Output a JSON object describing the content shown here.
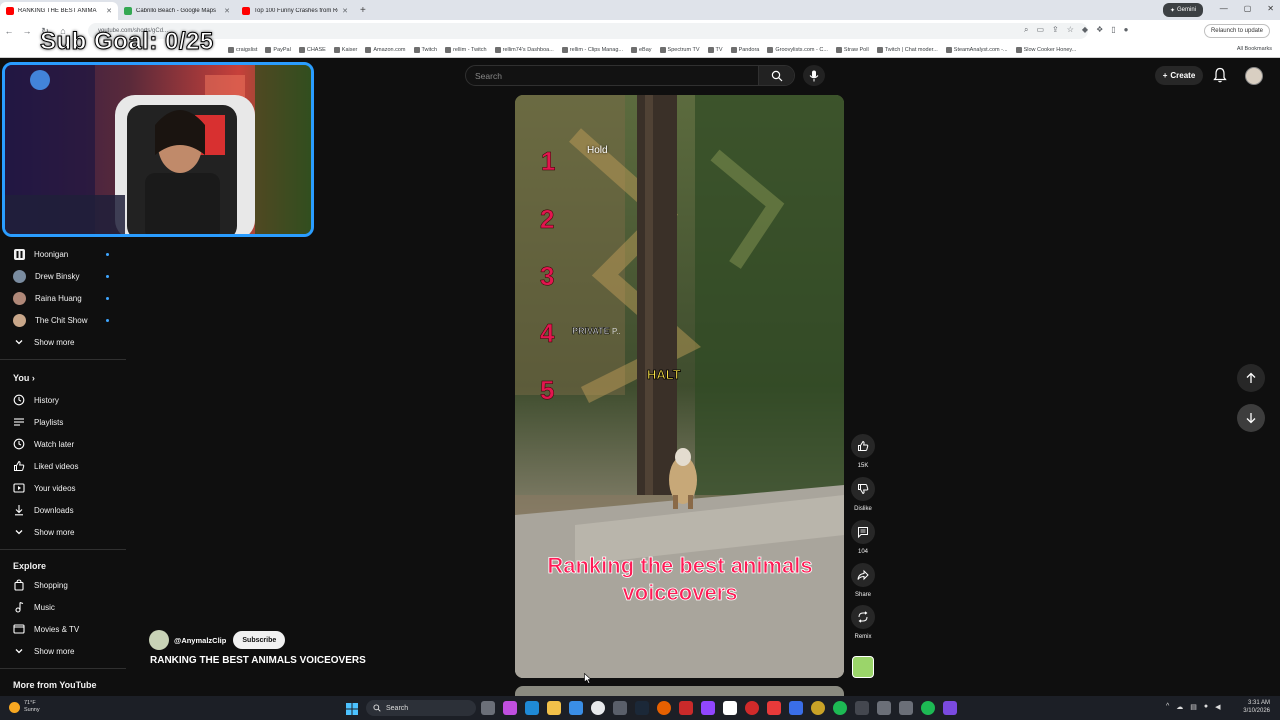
{
  "browser": {
    "tabs": [
      {
        "title": "RANKING THE BEST ANIMA",
        "favicon_color": "#ff0000",
        "active": true
      },
      {
        "title": "Cabrillo Beach - Google Maps",
        "favicon_color": "#34a853",
        "active": false
      },
      {
        "title": "Top 100 Funny Crashes from Re",
        "favicon_color": "#ff0000",
        "active": false
      }
    ],
    "gemini_label": "Gemini",
    "url": "youtube.com/shorts/gCd...",
    "relaunch_label": "Relaunch to update",
    "bookmarks": [
      "craigslist",
      "PayPal",
      "CHASE",
      "Kaiser",
      "Amazon.com",
      "Twitch",
      "rellim - Twitch",
      "rellim74's Dashboa...",
      "rellim - Clips Manag...",
      "eBay",
      "Spectrum TV",
      "TV",
      "Pandora",
      "Groovylists.com - C...",
      "Straw Poll",
      "Twitch | Chat moder...",
      "SteamAnalyst.com -...",
      "Slow Cooker Honey..."
    ],
    "all_bookmarks_label": "All Bookmarks"
  },
  "overlay": {
    "sub_goal": "Sub Goal: 0/25"
  },
  "header": {
    "search_placeholder": "Search",
    "create_label": "Create"
  },
  "sidebar": {
    "subscriptions": [
      {
        "label": "Hoonigan",
        "icon": "hoonigan-icon",
        "color": "#1a1a1a"
      },
      {
        "label": "Drew Binsky",
        "color": "#7a8ca0"
      },
      {
        "label": "Raina Huang",
        "color": "#b08878"
      },
      {
        "label": "The Chit Show",
        "color": "#c9a78a"
      }
    ],
    "show_more_1": "Show more",
    "you_heading": "You",
    "you_items": [
      {
        "label": "History",
        "icon": "history-icon"
      },
      {
        "label": "Playlists",
        "icon": "playlists-icon"
      },
      {
        "label": "Watch later",
        "icon": "watch-later-icon"
      },
      {
        "label": "Liked videos",
        "icon": "liked-icon"
      },
      {
        "label": "Your videos",
        "icon": "your-videos-icon"
      },
      {
        "label": "Downloads",
        "icon": "downloads-icon"
      }
    ],
    "show_more_2": "Show more",
    "explore_heading": "Explore",
    "explore_items": [
      {
        "label": "Shopping",
        "icon": "shopping-icon"
      },
      {
        "label": "Music",
        "icon": "music-icon"
      },
      {
        "label": "Movies & TV",
        "icon": "movies-icon"
      }
    ],
    "show_more_3": "Show more",
    "more_heading": "More from YouTube"
  },
  "video": {
    "rank_numbers": [
      "1",
      "2",
      "3",
      "4",
      "5"
    ],
    "hold_text": "Hold",
    "private_text": "PRIVATE",
    "private_suffix": "P..",
    "halt_text": "HALT",
    "caption_line1": "Ranking the best animals",
    "caption_line2": "voiceovers"
  },
  "actions": {
    "like_count": "15K",
    "dislike_label": "Dislike",
    "comment_count": "104",
    "share_label": "Share",
    "remix_label": "Remix"
  },
  "channel": {
    "handle": "@AnymalzClip",
    "subscribe_label": "Subscribe",
    "video_title": "RANKING THE BEST ANIMALS VOICEOVERS"
  },
  "taskbar": {
    "weather_temp": "71°F",
    "weather_cond": "Sunny",
    "search_label": "Search",
    "time": "3:31 AM",
    "date": "3/10/2026"
  }
}
